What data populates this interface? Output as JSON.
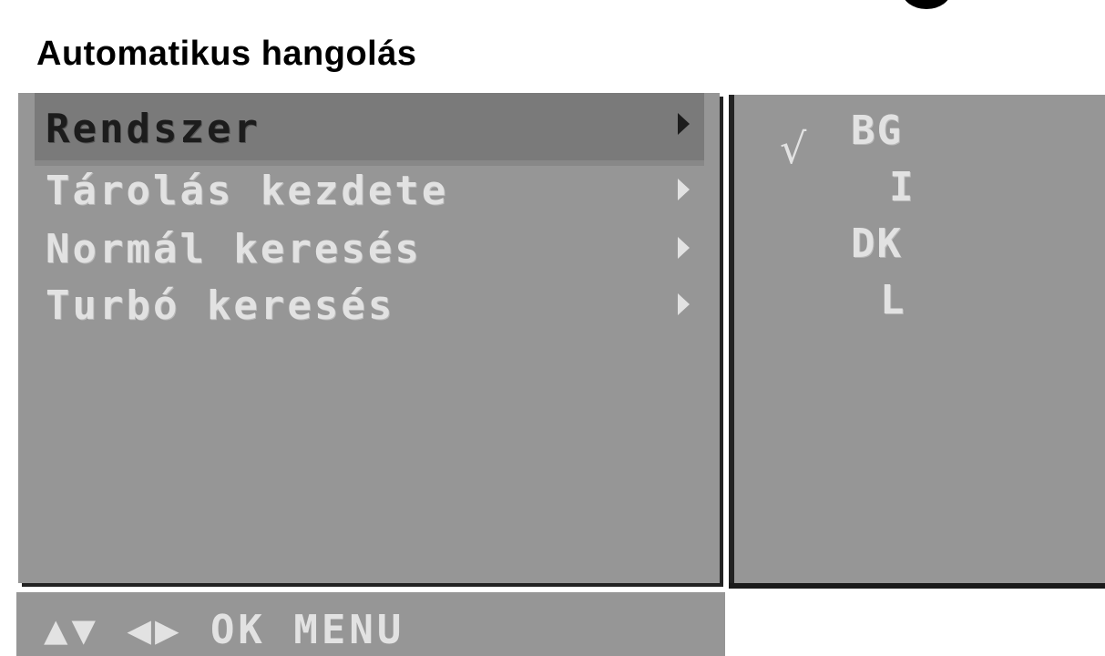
{
  "title": "Automatikus hangolás",
  "menu": {
    "items": [
      {
        "label": "Rendszer",
        "arrow": "right-arrow-icon",
        "selected": true
      },
      {
        "label": "Tárolás kezdete",
        "arrow": "right-arrow-icon",
        "selected": false
      },
      {
        "label": "Normál keresés",
        "arrow": "right-arrow-icon",
        "selected": false
      },
      {
        "label": "Turbó keresés",
        "arrow": "right-arrow-icon",
        "selected": false
      }
    ]
  },
  "options": {
    "check_mark": "√",
    "items": [
      {
        "label": "BG",
        "checked": true
      },
      {
        "label": "I",
        "checked": false
      },
      {
        "label": "DK",
        "checked": false
      },
      {
        "label": "L",
        "checked": false
      }
    ]
  },
  "footer": {
    "hint": "▲▼ ◀▶ OK MENU"
  },
  "colors": {
    "panel": "#969696",
    "highlight": "#7a7a7a",
    "text_light": "#e2e2e2",
    "text_dark": "#1c1c1c"
  }
}
